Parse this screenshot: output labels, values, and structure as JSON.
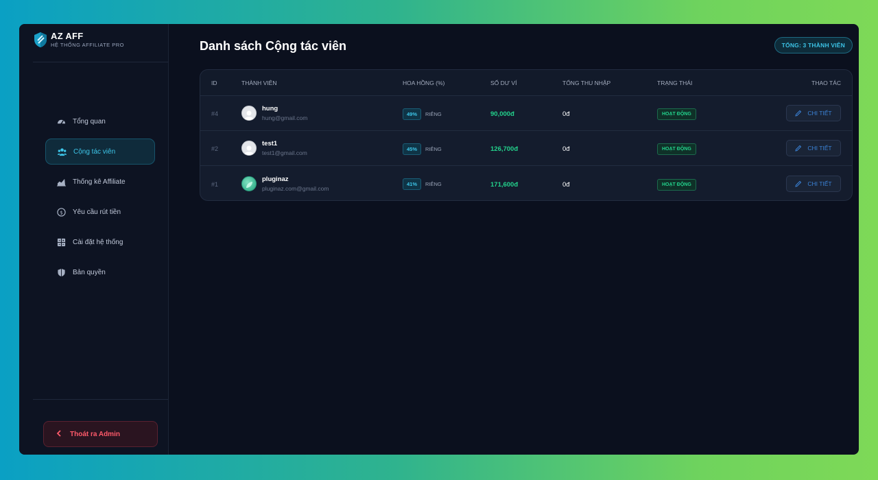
{
  "brand": {
    "title": "AZ AFF",
    "subtitle": "HỆ THỐNG AFFILIATE PRO",
    "icon": "shield-logo-icon"
  },
  "sidebar": {
    "items": [
      {
        "label": "Tổng quan",
        "icon": "dashboard-icon",
        "active": false
      },
      {
        "label": "Cộng tác viên",
        "icon": "users-icon",
        "active": true
      },
      {
        "label": "Thống kê Affiliate",
        "icon": "chart-icon",
        "active": false
      },
      {
        "label": "Yêu cầu rút tiền",
        "icon": "dollar-icon",
        "active": false
      },
      {
        "label": "Cài đặt hệ thống",
        "icon": "settings-grid-icon",
        "active": false
      },
      {
        "label": "Bản quyền",
        "icon": "shield-icon",
        "active": false
      }
    ],
    "logout_label": "Thoát ra Admin"
  },
  "main": {
    "title": "Danh sách Cộng tác viên",
    "total_badge": "TỔNG: 3 THÀNH VIÊN"
  },
  "table": {
    "headers": {
      "id": "ID",
      "member": "THÀNH VIÊN",
      "commission": "HOA HỒNG (%)",
      "balance": "SỐ DƯ VÍ",
      "income": "TỔNG THU NHẬP",
      "status": "TRẠNG THÁI",
      "action": "THAO TÁC"
    },
    "rows": [
      {
        "id": "#4",
        "name": "hung",
        "email": "hung@gmail.com",
        "pct": "49%",
        "pct_type": "RIÊNG",
        "balance": "90,000đ",
        "income": "0đ",
        "status": "HOẠT ĐỘNG",
        "action": "CHI TIẾT"
      },
      {
        "id": "#2",
        "name": "test1",
        "email": "test1@gmail.com",
        "pct": "45%",
        "pct_type": "RIÊNG",
        "balance": "126,700đ",
        "income": "0đ",
        "status": "HOẠT ĐỘNG",
        "action": "CHI TIẾT"
      },
      {
        "id": "#1",
        "name": "pluginaz",
        "email": "pluginaz.com@gmail.com",
        "pct": "41%",
        "pct_type": "RIÊNG",
        "balance": "171,600đ",
        "income": "0đ",
        "status": "HOẠT ĐỘNG",
        "action": "CHI TIẾT"
      }
    ]
  },
  "colors": {
    "accent": "#3ec7ea",
    "success": "#23d28c",
    "danger": "#ff5a6a",
    "background": "#0b101e"
  }
}
